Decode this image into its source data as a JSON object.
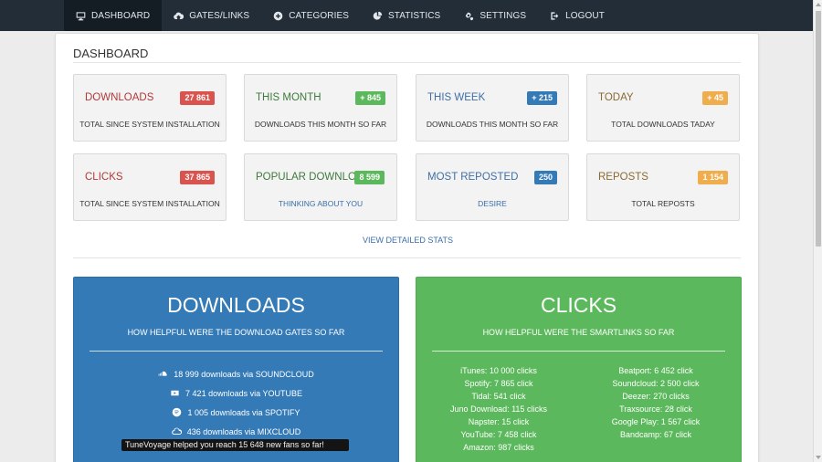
{
  "nav": {
    "items": [
      {
        "label": "DASHBOARD",
        "icon": "monitor-icon"
      },
      {
        "label": "GATES/LINKS",
        "icon": "cloud-download-icon"
      },
      {
        "label": "CATEGORIES",
        "icon": "plus-circle-icon"
      },
      {
        "label": "STATISTICS",
        "icon": "pie-chart-icon"
      },
      {
        "label": "SETTINGS",
        "icon": "gears-icon"
      },
      {
        "label": "LOGOUT",
        "icon": "sign-out-icon"
      }
    ]
  },
  "dashboard": {
    "title": "DASHBOARD",
    "view_detailed": "VIEW DETAILED STATS",
    "tiles": [
      {
        "label": "DOWNLOADS",
        "badge": "27 861",
        "sub": "TOTAL SINCE SYSTEM INSTALLATION",
        "color": "#d9534f"
      },
      {
        "label": "THIS MONTH",
        "badge": "+ 845",
        "sub": "DOWNLOADS THIS MONTH SO FAR",
        "color": "#5cb85c"
      },
      {
        "label": "THIS WEEK",
        "badge": "+ 215",
        "sub": "DOWNLOADS THIS MONTH SO FAR",
        "color": "#337ab7"
      },
      {
        "label": "TODAY",
        "badge": "+ 45",
        "sub": "TOTAL DOWNLOADS TADAY",
        "color": "#f0ad4e"
      },
      {
        "label": "CLICKS",
        "badge": "37 865",
        "sub": "TOTAL SINCE SYSTEM INSTALLATION",
        "color": "#d9534f"
      },
      {
        "label": "POPULAR DOWNLOAD",
        "badge": "8 599",
        "sub": "THINKING ABOUT YOU",
        "color": "#5cb85c"
      },
      {
        "label": "MOST REPOSTED",
        "badge": "250",
        "sub": "DESIRE",
        "color": "#337ab7"
      },
      {
        "label": "REPOSTS",
        "badge": "1 154",
        "sub": "TOTAL REPOSTS",
        "color": "#f0ad4e"
      }
    ]
  },
  "downloads_box": {
    "title": "DOWNLOADS",
    "subtitle": "HOW HELPFUL WERE THE DOWNLOAD GATES SO FAR",
    "color": "#337ab7",
    "items": [
      {
        "icon": "soundcloud-icon",
        "text": "18 999 downloads via SOUNDCLOUD"
      },
      {
        "icon": "youtube-icon",
        "text": "7 421 downloads via YOUTUBE"
      },
      {
        "icon": "spotify-icon",
        "text": "1 005 downloads via SPOTIFY"
      },
      {
        "icon": "mixcloud-icon",
        "text": "436 downloads via MIXCLOUD"
      }
    ]
  },
  "clicks_box": {
    "title": "CLICKS",
    "subtitle": "HOW HELPFUL WERE THE SMARTLINKS SO FAR",
    "color": "#5cb85c",
    "left": [
      "iTunes: 10 000 clicks",
      "Spotify: 7 865 click",
      "Tidal: 541 click",
      "Juno Download: 115 clicks",
      "Napster: 15 click",
      "YouTube: 7 458 click",
      "Amazon: 987 clicks"
    ],
    "right": [
      "Beatport: 6 452 click",
      "Soundcloud: 2 500 click",
      "Deezer: 270 clicks",
      "Traxsource: 28 click",
      "Google Play: 1 567 click",
      "Bandcamp: 67 click"
    ]
  },
  "toast": {
    "text": "TuneVoyage helped  you reach 15 648 new fans so far!"
  }
}
